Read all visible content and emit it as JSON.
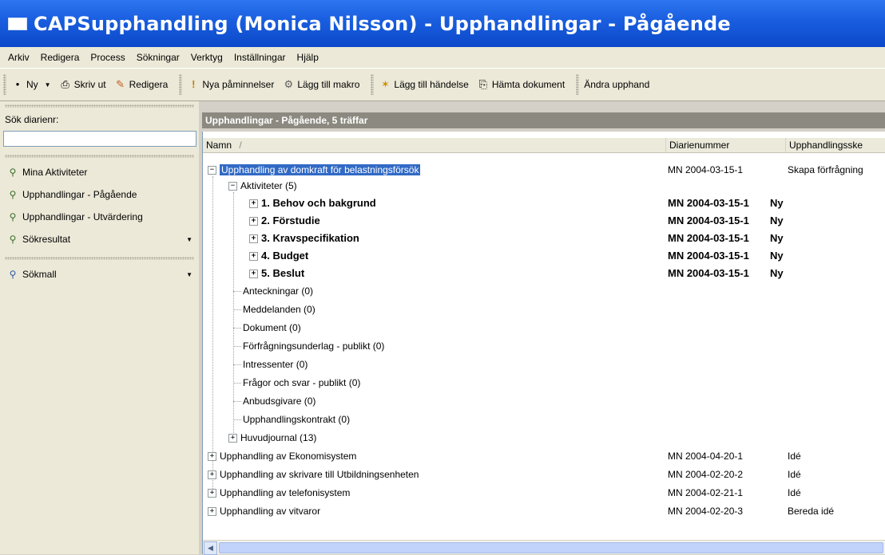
{
  "window": {
    "title": "CAPSupphandling (Monica Nilsson) - Upphandlingar - Pågående"
  },
  "menu": [
    "Arkiv",
    "Redigera",
    "Process",
    "Sökningar",
    "Verktyg",
    "Inställningar",
    "Hjälp"
  ],
  "toolbar": {
    "new": "Ny",
    "print": "Skriv ut",
    "edit": "Redigera",
    "reminders": "Nya påminnelser",
    "add_macro": "Lägg till makro",
    "add_event": "Lägg till händelse",
    "fetch_doc": "Hämta dokument",
    "change": "Ändra upphand"
  },
  "sidebar": {
    "search_label": "Sök diarienr:",
    "search_value": "",
    "items": [
      {
        "label": "Mina Aktiviteter"
      },
      {
        "label": "Upphandlingar - Pågående"
      },
      {
        "label": "Upphandlingar - Utvärdering"
      },
      {
        "label": "Sökresultat"
      }
    ],
    "template_item": "Sökmall"
  },
  "panel": {
    "header": "Upphandlingar - Pågående, 5 träffar"
  },
  "columns": {
    "name": "Namn",
    "sort": "/",
    "diarienummer": "Diarienummer",
    "stage": "Upphandlingsske"
  },
  "rows": {
    "r0": {
      "name": "Upphandling av domkraft för belastningsförsök",
      "nr": "MN 2004-03-15-1",
      "stage": "Skapa förfrågning"
    },
    "aktiviteter": "Aktiviteter (5)",
    "a1": {
      "name": "1. Behov och bakgrund",
      "nr": "MN 2004-03-15-1",
      "stage": "Ny"
    },
    "a2": {
      "name": "2. Förstudie",
      "nr": "MN 2004-03-15-1",
      "stage": "Ny"
    },
    "a3": {
      "name": "3. Kravspecifikation",
      "nr": "MN 2004-03-15-1",
      "stage": "Ny"
    },
    "a4": {
      "name": "4. Budget",
      "nr": "MN 2004-03-15-1",
      "stage": "Ny"
    },
    "a5": {
      "name": "5. Beslut",
      "nr": "MN 2004-03-15-1",
      "stage": "Ny"
    },
    "c1": "Anteckningar (0)",
    "c2": "Meddelanden (0)",
    "c3": "Dokument (0)",
    "c4": "Förfrågningsunderlag - publikt (0)",
    "c5": "Intressenter (0)",
    "c6": "Frågor och svar - publikt (0)",
    "c7": "Anbudsgivare (0)",
    "c8": "Upphandlingskontrakt (0)",
    "c9": "Huvudjournal (13)",
    "r1": {
      "name": "Upphandling av Ekonomisystem",
      "nr": "MN 2004-04-20-1",
      "stage": "Idé"
    },
    "r2": {
      "name": "Upphandling av skrivare till Utbildningsenheten",
      "nr": "MN 2004-02-20-2",
      "stage": "Idé"
    },
    "r3": {
      "name": "Upphandling av telefonisystem",
      "nr": "MN 2004-02-21-1",
      "stage": "Idé"
    },
    "r4": {
      "name": "Upphandling av vitvaror",
      "nr": "MN 2004-02-20-3",
      "stage": "Bereda idé"
    }
  }
}
